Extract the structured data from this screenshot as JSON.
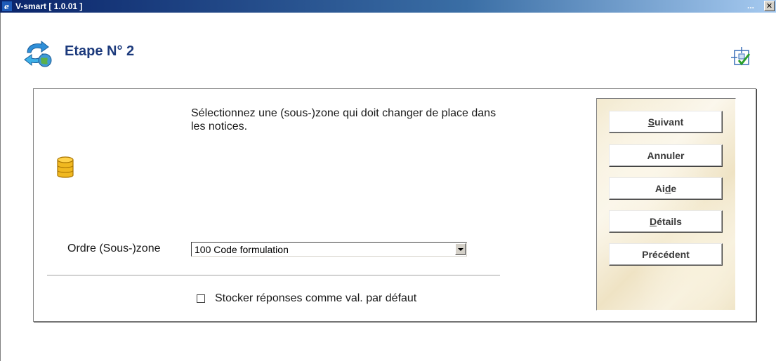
{
  "window": {
    "title": "V-smart [ 1.0.01 ]",
    "dots": "...",
    "close_glyph": "✕"
  },
  "page": {
    "title": "Etape N° 2"
  },
  "instruction": "Sélectionnez une (sous-)zone qui doit changer de place dans les notices.",
  "field": {
    "label": "Ordre (Sous-)zone",
    "value": "100 Code formulation"
  },
  "checkbox": {
    "label": "Stocker réponses comme val. par défaut",
    "checked": false
  },
  "buttons": {
    "next": {
      "pre": "",
      "key": "S",
      "post": "uivant"
    },
    "cancel": {
      "pre": "Annuler",
      "key": "",
      "post": ""
    },
    "help": {
      "pre": "Ai",
      "key": "d",
      "post": "e"
    },
    "details": {
      "pre": "",
      "key": "D",
      "post": "étails"
    },
    "previous": {
      "pre": "Précédent",
      "key": "",
      "post": ""
    }
  },
  "colors": {
    "title_blue": "#1c3a7c",
    "titlebar": "#0a246a"
  },
  "icons": [
    "ie-app-icon",
    "refresh-globe-icon",
    "workflow-check-icon",
    "database-icon",
    "close-icon",
    "chevron-down-icon"
  ]
}
